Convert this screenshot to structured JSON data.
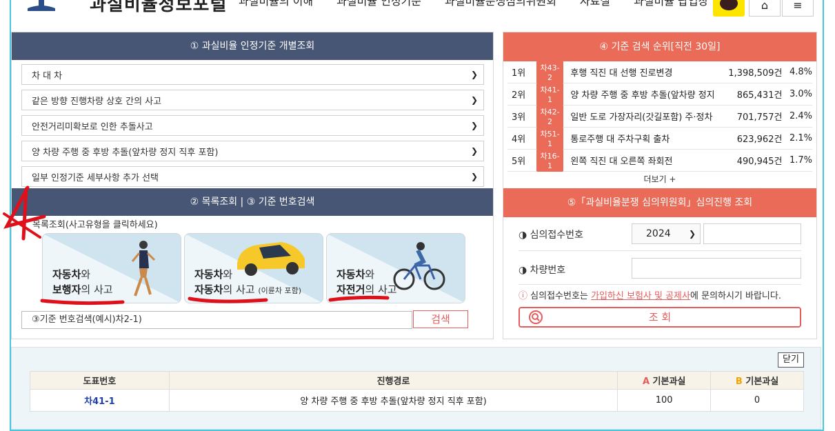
{
  "header": {
    "site_title": "과실비율정보포털",
    "nav": [
      "과실비율의 이해",
      "과실비율 인정기준",
      "과실비율분쟁심의위원회",
      "자료실",
      "과실비율 팝업창"
    ],
    "home_icon": "home-icon",
    "menu_icon": "hamburger-icon",
    "kakao_icon": "kakao-talk-icon"
  },
  "left_panel": {
    "section1_title": "① 과실비율 인정기준 개별조회",
    "selects": [
      "차 대 차",
      "같은 방향 진행차량 상호 간의 사고",
      "안전거리미확보로 인한 추돌사고",
      "양 차량 주행 중 후방 추돌(앞차량 정지 직후 포함)",
      "일부 인정기준 세부사항 추가 선택"
    ],
    "section2_title": "② 목록조회 | ③ 기준 번호검색",
    "category_note": "목록조회(사고유형을 클릭하세요)",
    "cards": [
      {
        "line1_bold": "자동차",
        "line1_rest": "와",
        "line2_bold": "보행자",
        "line2_rest": "의 사고",
        "sub": ""
      },
      {
        "line1_bold": "자동차",
        "line1_rest": "와",
        "line2_bold": "자동차",
        "line2_rest": "의 사고",
        "sub": "(이륜차 포함)"
      },
      {
        "line1_bold": "자동차",
        "line1_rest": "와",
        "line2_bold": "자전거",
        "line2_rest": "의 사고",
        "sub": ""
      }
    ],
    "search_placeholder": "③기준 번호검색(예시)차2-1)",
    "search_button": "검색"
  },
  "right_panel": {
    "section4_title": "④ 기준 검색 순위[직전 30일]",
    "ranking": [
      {
        "rank": "1위",
        "code": "차43-2",
        "title": "후행 직진 대 선행 진로변경",
        "count": "1,398,509건",
        "pct": "4.8%"
      },
      {
        "rank": "2위",
        "code": "차41-1",
        "title": "양 차량 주행 중 후방 추돌(앞차량 정지",
        "count": "865,431건",
        "pct": "3.0%"
      },
      {
        "rank": "3위",
        "code": "차42-2",
        "title": "일반 도로 가장자리(갓길포함) 주·정차",
        "count": "701,757건",
        "pct": "2.4%"
      },
      {
        "rank": "4위",
        "code": "차51-1",
        "title": "통로주행 대 주차구획 출차",
        "count": "623,962건",
        "pct": "2.1%"
      },
      {
        "rank": "5위",
        "code": "차16-1",
        "title": "왼쪽 직진 대 오른쪽 좌회전",
        "count": "490,945건",
        "pct": "1.7%"
      }
    ],
    "more_label": "더보기 +",
    "section5_title": "⑤「과실비율분쟁 심의위원회」심의진행 조회",
    "receipt_label": "◑ 심의접수번호",
    "year_value": "2024",
    "vehicle_label": "◑ 차량번호",
    "notice_prefix": "ⓘ",
    "notice_text_1": "심의접수번호는 ",
    "notice_link": "가입하신 보험사 및 공제사",
    "notice_text_2": "에 문의하시기 바랍니다.",
    "inquiry_button": "조 회"
  },
  "result": {
    "close_button": "닫기",
    "headers": {
      "code": "도표번호",
      "route": "진행경로",
      "a_mark": "A",
      "a_text": " 기본과실",
      "b_mark": "B",
      "b_text": " 기본과실"
    },
    "row": {
      "code": "차41-1",
      "route": "양 차량 주행 중 후방 추돌(앞차량 정지 직후 포함)",
      "a": "100",
      "b": "0"
    }
  },
  "colors": {
    "navy": "#475675",
    "coral": "#ea6b57",
    "accent_red": "#e55c5c",
    "annotation_red": "#e0101a",
    "frame_cyan": "#46c8e0"
  }
}
